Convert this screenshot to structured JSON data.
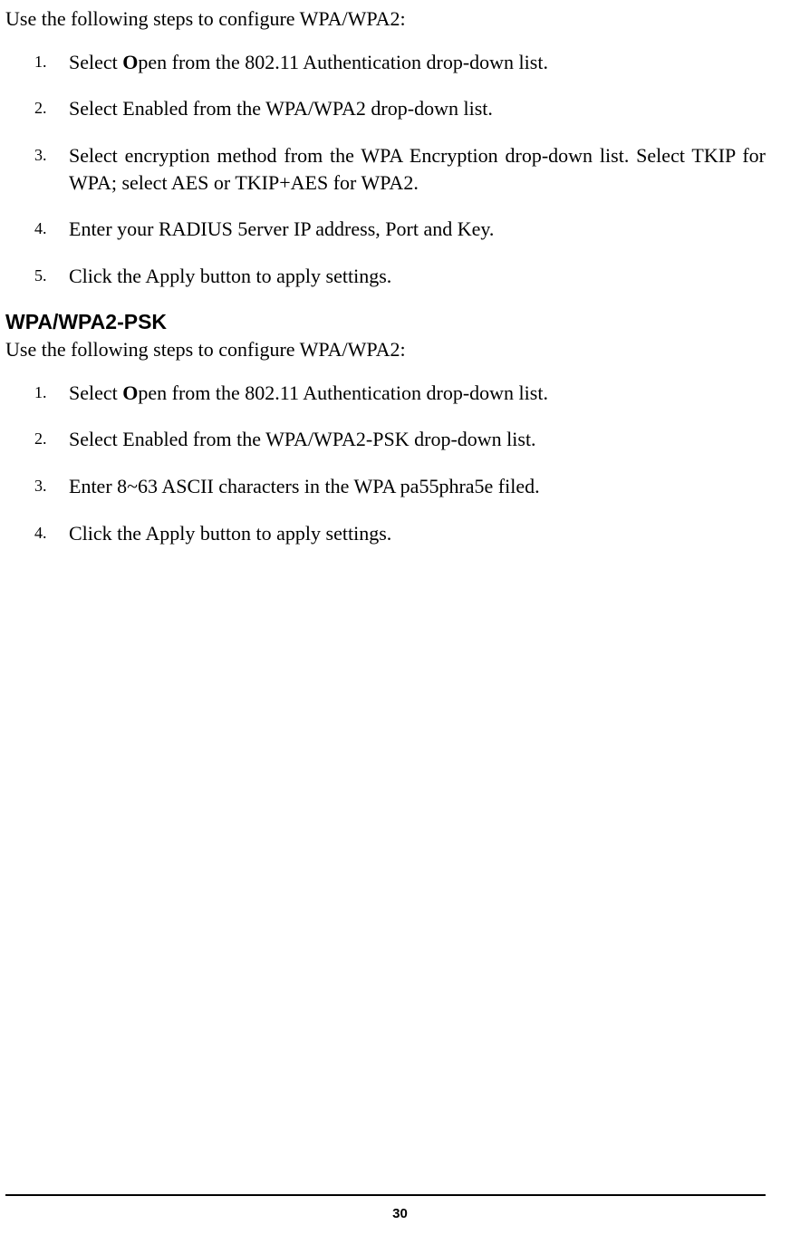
{
  "section1": {
    "intro": "Use the following steps to configure WPA/WPA2:",
    "steps": [
      {
        "n": "1.",
        "text_pre": "Select ",
        "bold": "O",
        "text_mid": "pen from the 802.11 Au",
        "bold2": "thentication",
        "text_post": " drop-down list."
      },
      {
        "n": "2.",
        "text": "Select Enabled from the WPA/WPA2 drop-down list."
      },
      {
        "n": "3.",
        "text": "Select encryption method from the WPA Encryption drop-down list. Select TKIP for WPA; select AES or TKIP+AES for WPA2."
      },
      {
        "n": "4.",
        "text": " Enter your RADIUS 5erver IP address, Port and Key."
      },
      {
        "n": "5.",
        "text": "Click the Apply button to apply settings."
      }
    ]
  },
  "section2": {
    "heading": "WPA/WPA2-PSK",
    "intro": "Use the following steps to configure WPA/WPA2:",
    "steps": [
      {
        "n": "1.",
        "text_pre": "Select ",
        "bold": "O",
        "text_mid": "pen from the 802.11 Au",
        "bold2": "thentication",
        "text_post": " drop-down list."
      },
      {
        "n": "2.",
        "text": "Select Enabled from the WPA/WPA2-PSK drop-down list."
      },
      {
        "n": "3.",
        "text": "Enter 8~63 ASCII characters in the WPA pa55phra5e filed."
      },
      {
        "n": "4.",
        "text": "Click the Apply button to apply settings."
      }
    ]
  },
  "page_number": "30"
}
